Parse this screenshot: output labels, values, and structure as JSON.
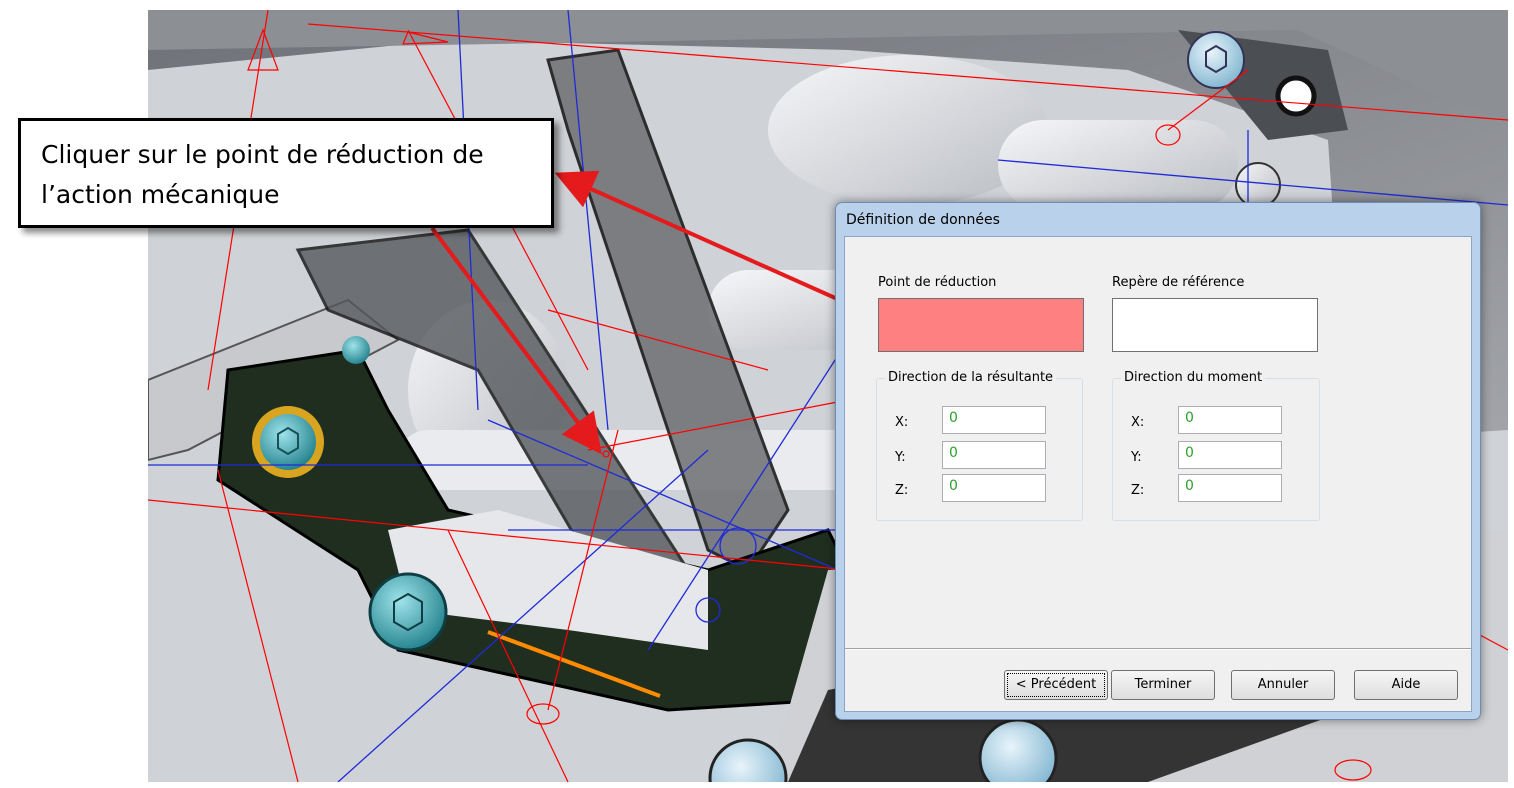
{
  "callout": {
    "line1": "Cliquer sur le point de réduction de",
    "line2": "l’action mécanique"
  },
  "dialog": {
    "title": "Définition de données",
    "point_label": "Point de réduction",
    "point_value": "",
    "point_color": "#ff8080",
    "repere_label": "Repère de référence",
    "repere_value": "",
    "resultante": {
      "title": "Direction de la résultante",
      "x_label": "X:",
      "y_label": "Y:",
      "z_label": "Z:",
      "x": "0",
      "y": "0",
      "z": "0"
    },
    "moment": {
      "title": "Direction du moment",
      "x_label": "X:",
      "y_label": "Y:",
      "z_label": "Z:",
      "x": "0",
      "y": "0",
      "z": "0"
    },
    "buttons": {
      "previous": "< Précédent",
      "finish": "Terminer",
      "cancel": "Annuler",
      "help": "Aide"
    }
  },
  "colors": {
    "arrow": "#e41a1c",
    "value_text": "#2ca02c",
    "dark_part": "#1f2e1f",
    "screw": "#3aa7b0"
  }
}
